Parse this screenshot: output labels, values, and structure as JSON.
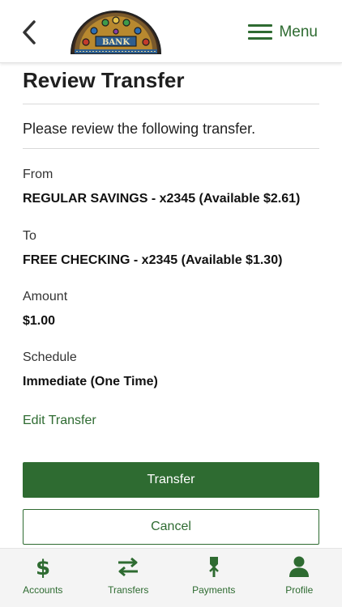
{
  "header": {
    "back_icon": "chevron-left-icon",
    "logo_text": "BANK",
    "menu_label": "Menu",
    "menu_icon": "hamburger-icon"
  },
  "colors": {
    "brand_green": "#2e6b31",
    "tabbar_bg": "#f4f4f4"
  },
  "page": {
    "title": "Review Transfer",
    "instructions": "Please review the following transfer."
  },
  "transfer": {
    "from_label": "From",
    "from_value": "REGULAR SAVINGS - x2345 (Available  $2.61)",
    "to_label": "To",
    "to_value": "FREE CHECKING - x2345 (Available  $1.30)",
    "amount_label": "Amount",
    "amount_value": "$1.00",
    "schedule_label": "Schedule",
    "schedule_value": "Immediate (One Time)"
  },
  "actions": {
    "edit_label": "Edit Transfer",
    "submit_label": "Transfer",
    "cancel_label": "Cancel"
  },
  "tabbar": {
    "tabs": [
      {
        "label": "Accounts",
        "icon": "dollar-icon"
      },
      {
        "label": "Transfers",
        "icon": "swap-arrows-icon"
      },
      {
        "label": "Payments",
        "icon": "payments-icon"
      },
      {
        "label": "Profile",
        "icon": "person-icon"
      }
    ]
  }
}
